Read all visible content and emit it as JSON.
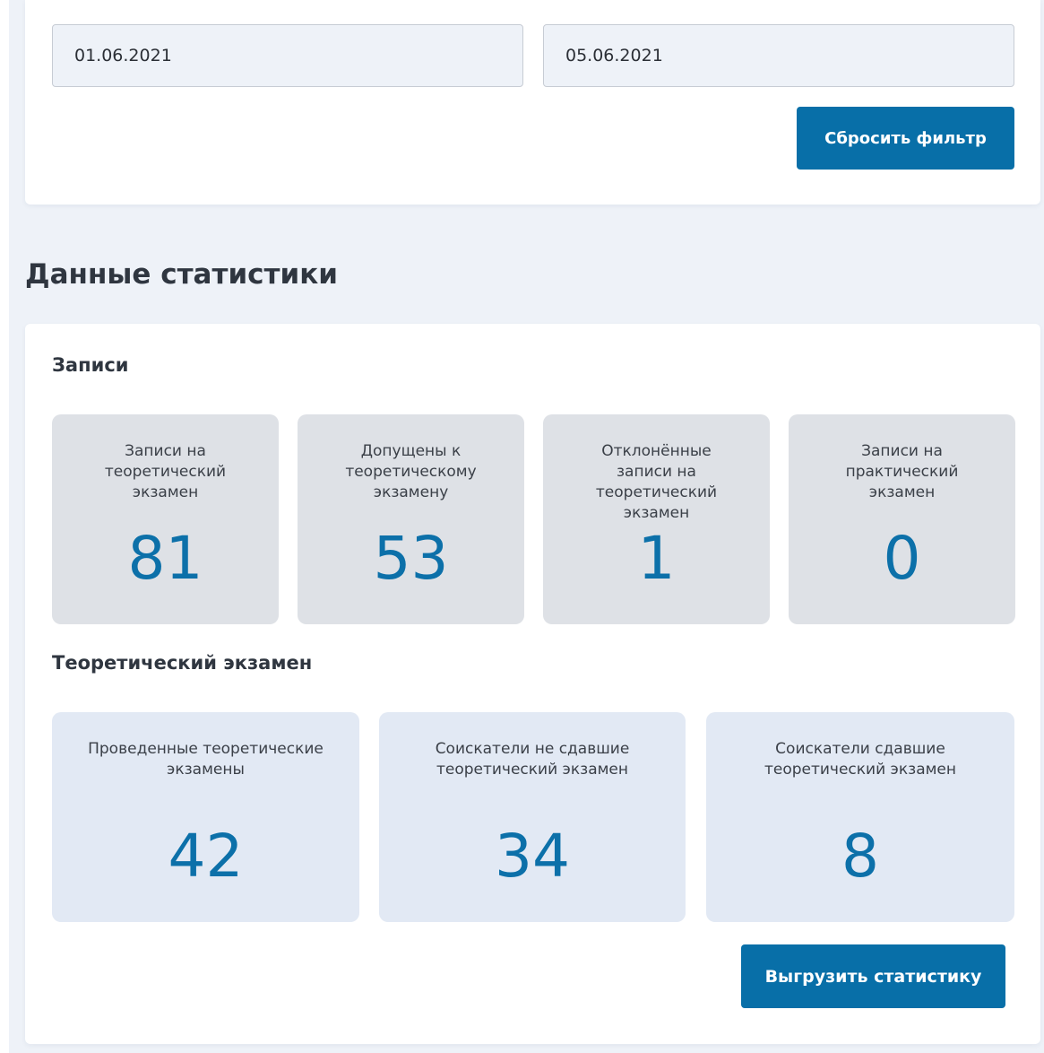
{
  "filter": {
    "date_from": "01.06.2021",
    "date_to": "05.06.2021",
    "reset_label": "Сбросить фильтр"
  },
  "stats": {
    "title": "Данные статистики",
    "records": {
      "title": "Записи",
      "cards": [
        {
          "label": "Записи на\nтеоретический\nэкзамен",
          "value": "81"
        },
        {
          "label": "Допущены к\nтеоретическому\nэкзамену",
          "value": "53"
        },
        {
          "label": "Отклонённые\nзаписи на\nтеоретический\nэкзамен",
          "value": "1"
        },
        {
          "label": "Записи на\nпрактический\nэкзамен",
          "value": "0"
        }
      ]
    },
    "theory": {
      "title": "Теоретический экзамен",
      "cards": [
        {
          "label": "Проведенные теоретические\nэкзамены",
          "value": "42"
        },
        {
          "label": "Соискатели не сдавшие\nтеоретический экзамен",
          "value": "34"
        },
        {
          "label": "Соискатели сдавшие\nтеоретический экзамен",
          "value": "8"
        }
      ]
    },
    "export_label": "Выгрузить статистику"
  },
  "colors": {
    "accent": "#086fa8",
    "value_blue": "#0c70a9",
    "page_bg": "#eef2f8"
  }
}
